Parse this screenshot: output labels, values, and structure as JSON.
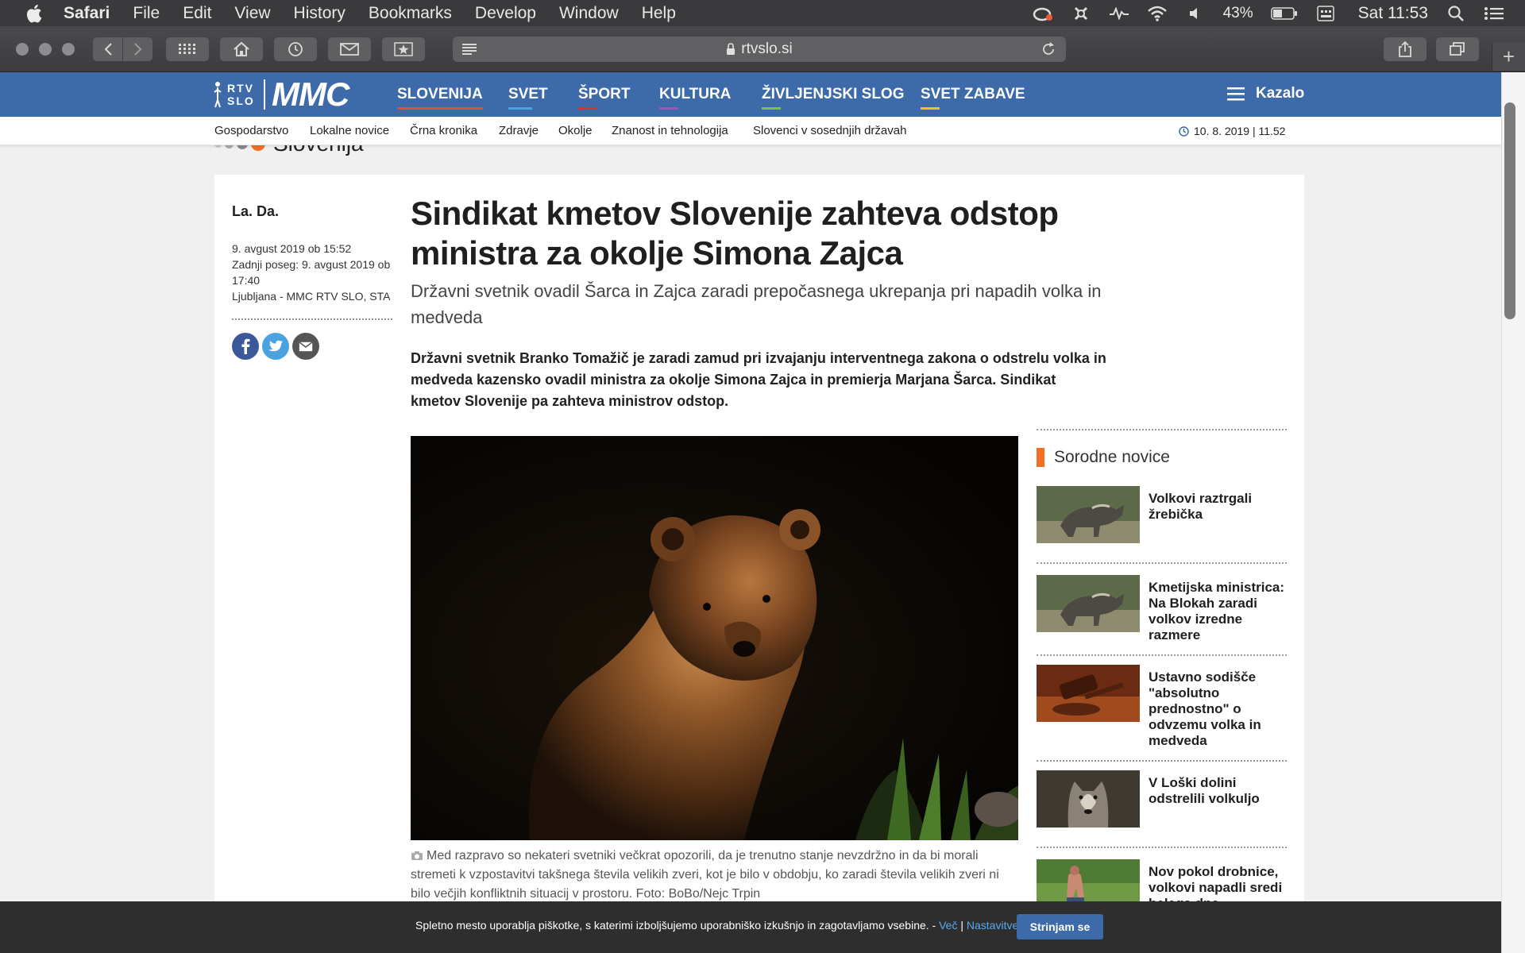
{
  "menubar": {
    "app": "Safari",
    "items": [
      "File",
      "Edit",
      "View",
      "History",
      "Bookmarks",
      "Develop",
      "Window",
      "Help"
    ],
    "battery": "43%",
    "clock": "Sat 11:53"
  },
  "browser": {
    "url": "rtvslo.si"
  },
  "site": {
    "logo_small": "RTV SLO",
    "logo_big": "MMC",
    "nav": [
      {
        "label": "SLOVENIJA",
        "color": "#e4502b"
      },
      {
        "label": "SVET",
        "color": "#4aa3df"
      },
      {
        "label": "ŠPORT",
        "color": "#d9302f"
      },
      {
        "label": "KULTURA",
        "color": "#9b59b6"
      },
      {
        "label": "ŽIVLJENJSKI SLOG",
        "color": "#7dc243"
      },
      {
        "label": "SVET ZABAVE",
        "color": "#f2c318"
      }
    ],
    "menu_label": "Kazalo",
    "subnav": [
      "Gospodarstvo",
      "Lokalne novice",
      "Črna kronika",
      "Zdravje",
      "Okolje",
      "Znanost in tehnologija",
      "Slovenci v sosednjih državah"
    ],
    "datetime": "10. 8. 2019 | 11.52"
  },
  "section": {
    "label": "Slovenija"
  },
  "article": {
    "author": "La. Da.",
    "published": "9. avgust 2019 ob 15:52",
    "updated": "Zadnji poseg: 9. avgust 2019 ob 17:40",
    "source": "Ljubljana - MMC RTV SLO, STA",
    "title": "Sindikat kmetov Slovenije zahteva odstop ministra za okolje Simona Zajca",
    "subtitle": "Državni svetnik ovadil Šarca in Zajca zaradi prepočasnega ukrepanja pri napadih volka in medveda",
    "lead": "Državni svetnik Branko Tomažič je zaradi zamud pri izvajanju interventnega zakona o odstrelu volka in medveda kazensko ovadil ministra za okolje Simona Zajca in premierja Marjana Šarca. Sindikat kmetov Slovenije pa zahteva ministrov odstop.",
    "caption": "Med razpravo so nekateri svetniki večkrat opozorili, da je trenutno stanje nevzdržno in da bi morali stremeti k vzpostavitvi takšnega števila velikih zveri, kot je bilo v obdobju, ko zaradi števila velikih zveri ni bilo večjih konfliktnih situacij v prostoru. Foto: BoBo/Nejc Trpin"
  },
  "related": {
    "heading": "Sorodne novice",
    "items": [
      {
        "title": "Volkovi raztrgali žrebička",
        "thumb": "wolf"
      },
      {
        "title": "Kmetijska ministrica: Na Blokah zaradi volkov izredne razmere",
        "thumb": "wolf"
      },
      {
        "title": "Ustavno sodišče \"absolutno prednostno\" o odvzemu volka in medveda",
        "thumb": "gavel"
      },
      {
        "title": "V Loški dolini odstrelili volkuljo",
        "thumb": "wolf-face"
      },
      {
        "title": "Nov pokol drobnice, volkovi napadli sredi belega dne",
        "thumb": "farmer"
      }
    ]
  },
  "cookie": {
    "text": "Spletno mesto uporablja piškotke, s katerimi izboljšujemo uporabniško izkušnjo in zagotavljamo vsebine. -",
    "more": "Več",
    "divider": "|",
    "settings": "Nastavitve",
    "accept": "Strinjam se"
  }
}
